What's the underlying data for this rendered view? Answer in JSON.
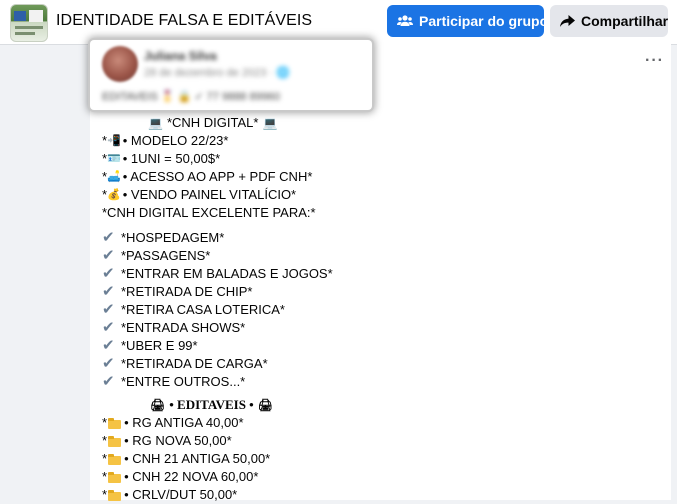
{
  "header": {
    "group_name": "IDENTIDADE FALSA E EDITÁVEIS",
    "join_label": "Participar do grupo",
    "share_label": "Compartilhar"
  },
  "post": {
    "more_label": "···",
    "shared_card": {
      "author": "Juliana Silva",
      "date": "28 de dezembro de 2023 · 🌐",
      "text": "EDITAVEIS 🎖️ 🔒 ✓ 77 9888 89960"
    },
    "cnh_title": "*CNH DIGITAL*",
    "cnh_items": [
      {
        "icon": "📲",
        "text": " • MODELO 22/23*"
      },
      {
        "icon": "🪪",
        "text": " • 1UNI = 50,00$*"
      },
      {
        "icon": "🛋️",
        "text": " • ACESSO AO APP + PDF CNH*"
      },
      {
        "icon": "💰",
        "text": " • VENDO PAINEL VITALÍCIO*"
      }
    ],
    "cnh_excellent": "*CNH DIGITAL EXCELENTE PARA:*",
    "check_items": [
      "*HOSPEDAGEM*",
      "*PASSAGENS*",
      "*ENTRAR EM BALADAS E JOGOS*",
      "*RETIRADA DE CHIP*",
      "*RETIRA CASA LOTERICA*",
      "*ENTRADA SHOWS*",
      "*UBER E 99*",
      "*RETIRADA DE CARGA*",
      "*ENTRE OUTROS...*"
    ],
    "editaveis_title": "• EDITAVEIS •",
    "editaveis_items": [
      " • RG ANTIGA  40,00*",
      " • RG NOVA  50,00*",
      " • CNH 21 ANTIGA 50,00*",
      " • CNH 22 NOVA  60,00*",
      " • CRLV/DUT 50,00*"
    ]
  }
}
